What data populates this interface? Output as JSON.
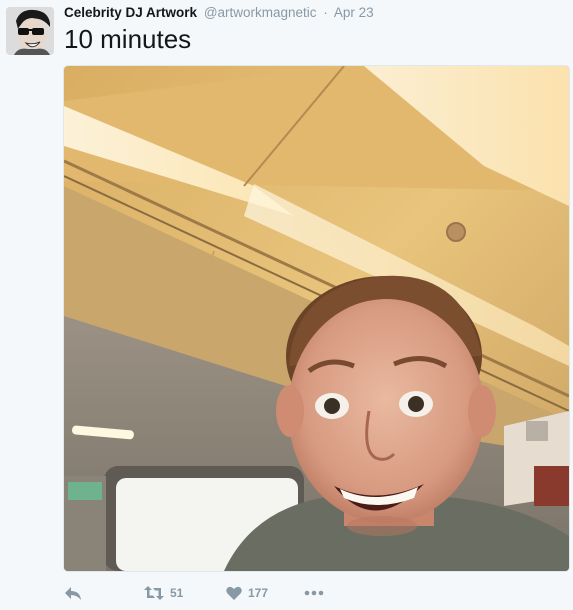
{
  "tweet": {
    "display_name": "Celebrity DJ Artwork",
    "handle": "@artworkmagnetic",
    "separator": "·",
    "date": "Apr 23",
    "text": "10 minutes"
  },
  "icons": {
    "avatar": "avatar-photo",
    "media": "selfie-photo",
    "reply": "reply-icon",
    "retweet": "retweet-icon",
    "like": "heart-icon",
    "more": "more-icon"
  },
  "actions": {
    "retweet_count": "51",
    "like_count": "177"
  },
  "colors": {
    "background": "#f5f8fa",
    "name": "#14171a",
    "meta": "#8899a6"
  }
}
